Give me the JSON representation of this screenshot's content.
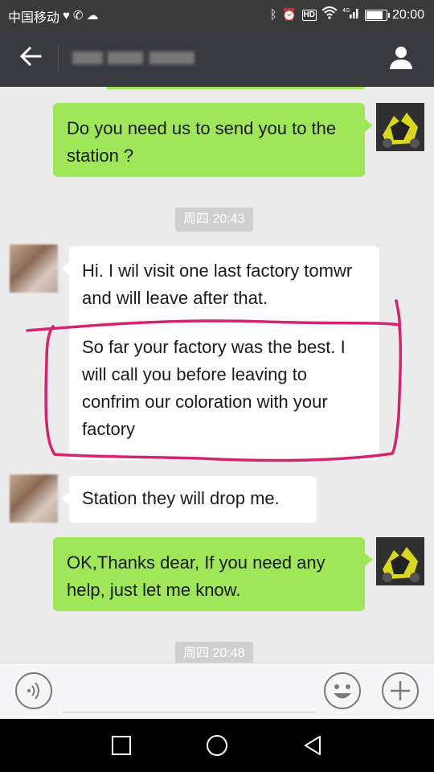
{
  "status_bar": {
    "carrier": "中国移动",
    "time": "20:00",
    "network": "4G",
    "battery_level": 0.85,
    "icons": [
      "heart-icon",
      "whatsapp-icon",
      "cloud-icon",
      "bluetooth-icon",
      "alarm-icon",
      "hd-icon",
      "wifi-icon",
      "signal-icon",
      "battery-icon"
    ]
  },
  "header": {
    "back_icon": "arrow-left-icon",
    "contact_icon": "person-icon"
  },
  "messages": [
    {
      "id": "m1",
      "direction": "outgoing",
      "text": "Do you need us to send you to the station ?"
    },
    {
      "id": "ts1",
      "type": "timestamp",
      "text": "周四 20:43"
    },
    {
      "id": "m2",
      "direction": "incoming",
      "parts": [
        "Hi. I wil visit one last factory tomwr and will leave after that.",
        "So far your factory was the best. I will call you before leaving to confrim our coloration with your factory"
      ]
    },
    {
      "id": "m3",
      "direction": "incoming",
      "text": "Station they will drop me."
    },
    {
      "id": "m4",
      "direction": "outgoing",
      "text": "OK,Thanks dear, If you need any help, just let me know."
    },
    {
      "id": "ts2",
      "type": "timestamp",
      "text": "周四 20:48"
    }
  ],
  "annotation": {
    "color": "#d4236f"
  },
  "input_bar": {
    "voice_icon": "voice-icon",
    "emoji_icon": "smiley-icon",
    "plus_icon": "plus-icon",
    "text_value": ""
  },
  "nav_bar": {
    "icons": [
      "square-recents-icon",
      "circle-home-icon",
      "triangle-back-icon"
    ]
  },
  "colors": {
    "outgoing_bubble": "#9fe658",
    "incoming_bubble": "#ffffff",
    "chat_background": "#ebebeb",
    "header_background": "#393a3f"
  }
}
